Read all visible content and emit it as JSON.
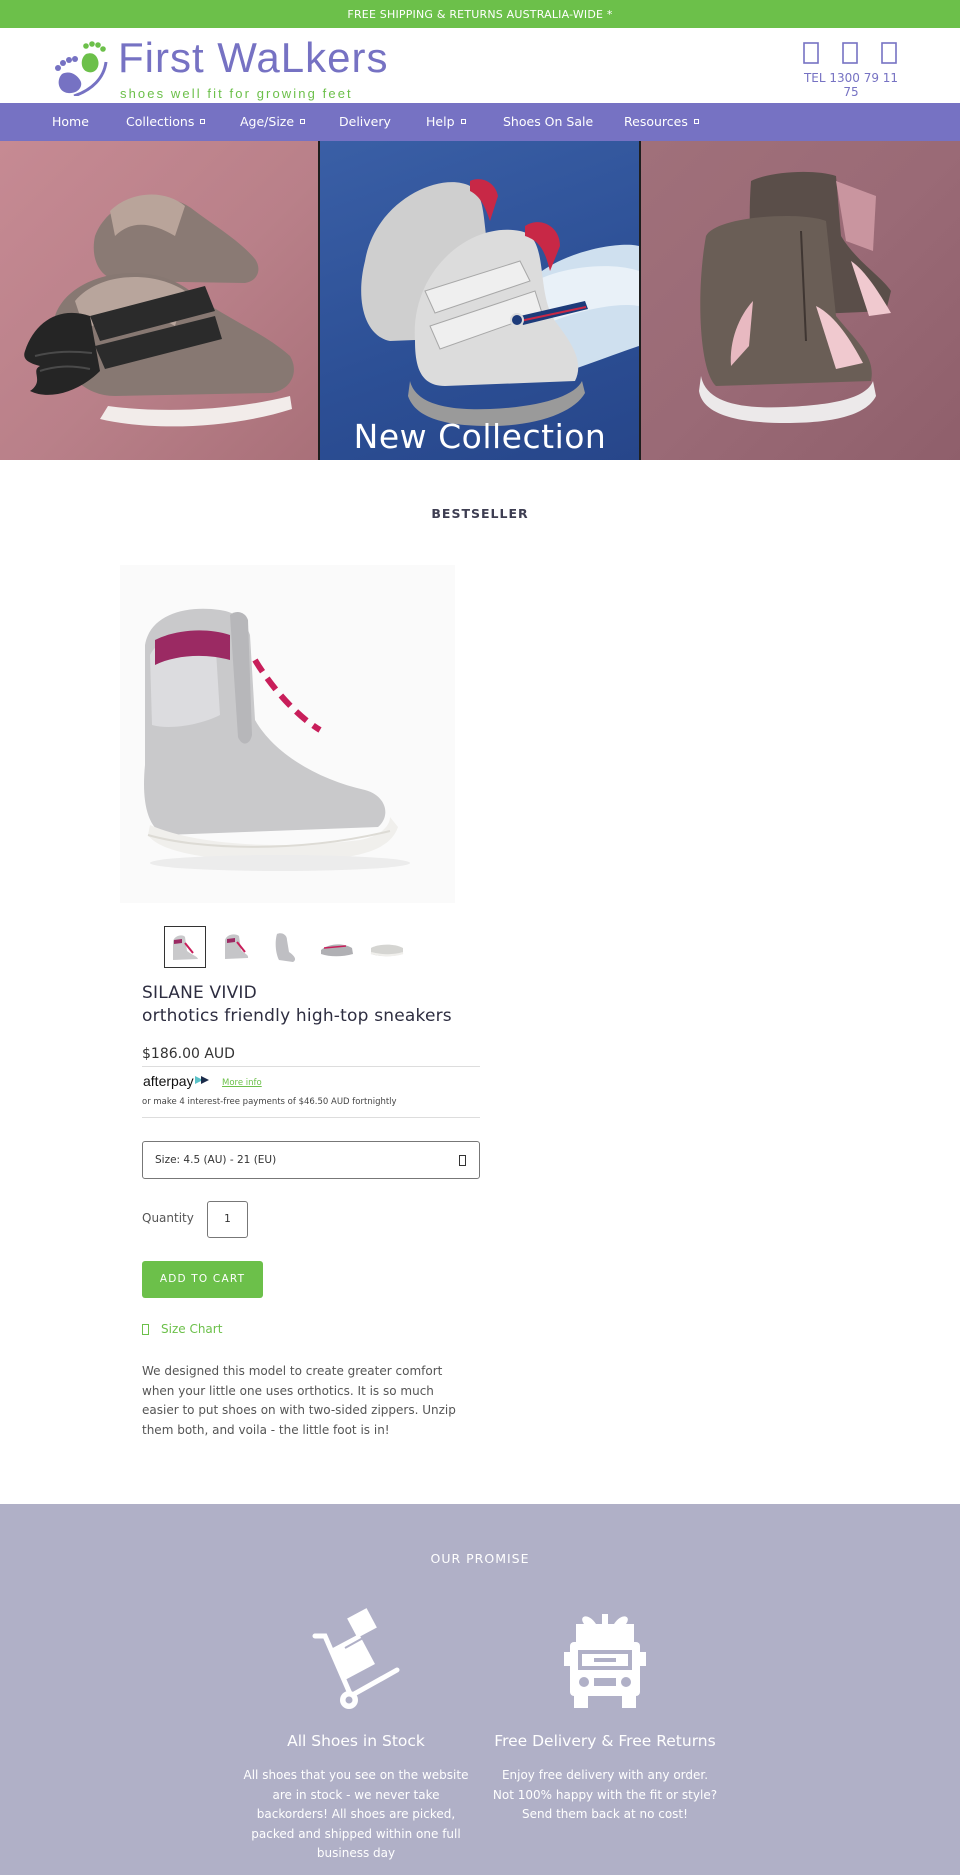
{
  "announcement": "FREE SHIPPING & RETURNS AUSTRALIA-WIDE *",
  "brand": {
    "name": "First WaLkers",
    "tagline": "shoes well fit for growing feet",
    "primary_color": "#7672c3",
    "accent_color": "#6cc04a"
  },
  "header": {
    "icons": [
      "search-icon",
      "user-icon",
      "cart-icon"
    ],
    "phone": "TEL 1300 79 11 75"
  },
  "nav": {
    "items": [
      {
        "label": "Home",
        "has_dropdown": false
      },
      {
        "label": "Collections",
        "has_dropdown": true
      },
      {
        "label": "Age/Size",
        "has_dropdown": true
      },
      {
        "label": "Delivery",
        "has_dropdown": false
      },
      {
        "label": "Help",
        "has_dropdown": true
      },
      {
        "label": "Shoes On Sale",
        "has_dropdown": false
      },
      {
        "label": "Resources",
        "has_dropdown": true
      }
    ]
  },
  "hero": {
    "caption": "New Collection"
  },
  "section_title": "BESTSELLER",
  "product": {
    "title_line1": "SILANE VIVID",
    "title_line2": "orthotics friendly high-top sneakers",
    "price": "$186.00 AUD",
    "afterpay": {
      "logo_text": "afterpay",
      "more_info": "More info",
      "note": "or make 4 interest-free payments of $46.50 AUD fortnightly"
    },
    "size_select": {
      "label": "Size: 4.5 (AU) - 21 (EU)"
    },
    "quantity": {
      "label": "Quantity",
      "value": "1"
    },
    "add_to_cart": "ADD TO CART",
    "size_chart": "Size Chart",
    "description": "We designed this model to create greater comfort when your little one uses orthotics. It is so much easier to put shoes on with two-sided zippers. Unzip them both, and voila - the little foot is in!",
    "thumbnail_count": 5,
    "active_thumbnail": 1
  },
  "promise": {
    "title": "OUR PROMISE",
    "items": [
      {
        "icon": "hand-truck-icon",
        "heading": "All Shoes in Stock",
        "text": "All shoes that you see on the website are in stock - we never take backorders! All shoes are picked, packed and shipped within one full business day"
      },
      {
        "icon": "delivery-truck-icon",
        "heading": "Free Delivery & Free Returns",
        "text": "Enjoy free delivery with any order. Not 100% happy with the fit or style? Send them back at no cost!"
      }
    ]
  }
}
